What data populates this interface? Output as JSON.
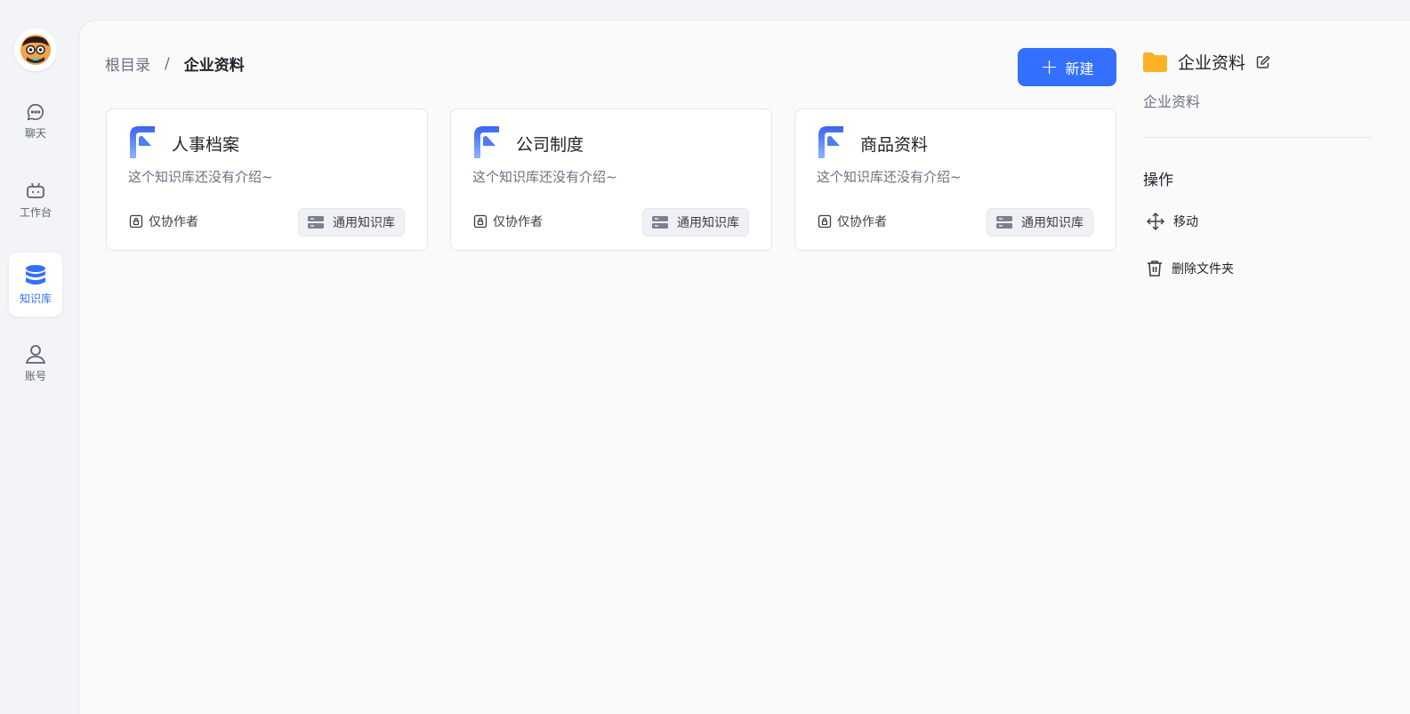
{
  "nav": {
    "items": [
      {
        "label": "聊天",
        "icon": "chat-icon"
      },
      {
        "label": "工作台",
        "icon": "robot-icon"
      },
      {
        "label": "知识库",
        "icon": "database-icon",
        "active": true
      },
      {
        "label": "账号",
        "icon": "user-icon"
      }
    ]
  },
  "breadcrumb": {
    "root": "根目录",
    "separator": "/",
    "current": "企业资料"
  },
  "toolbar": {
    "new_label": "新建",
    "accent": "#3370ff"
  },
  "cards": [
    {
      "title": "人事档案",
      "desc": "这个知识库还没有介绍~",
      "permission": "仅协作者",
      "tag": "通用知识库"
    },
    {
      "title": "公司制度",
      "desc": "这个知识库还没有介绍~",
      "permission": "仅协作者",
      "tag": "通用知识库"
    },
    {
      "title": "商品资料",
      "desc": "这个知识库还没有介绍~",
      "permission": "仅协作者",
      "tag": "通用知识库"
    }
  ],
  "detail": {
    "title": "企业资料",
    "subtitle": "企业资料",
    "ops_title": "操作",
    "ops": [
      {
        "label": "移动",
        "icon": "move-icon"
      },
      {
        "label": "删除文件夹",
        "icon": "trash-icon"
      }
    ],
    "folder_color": "#fbb224"
  }
}
